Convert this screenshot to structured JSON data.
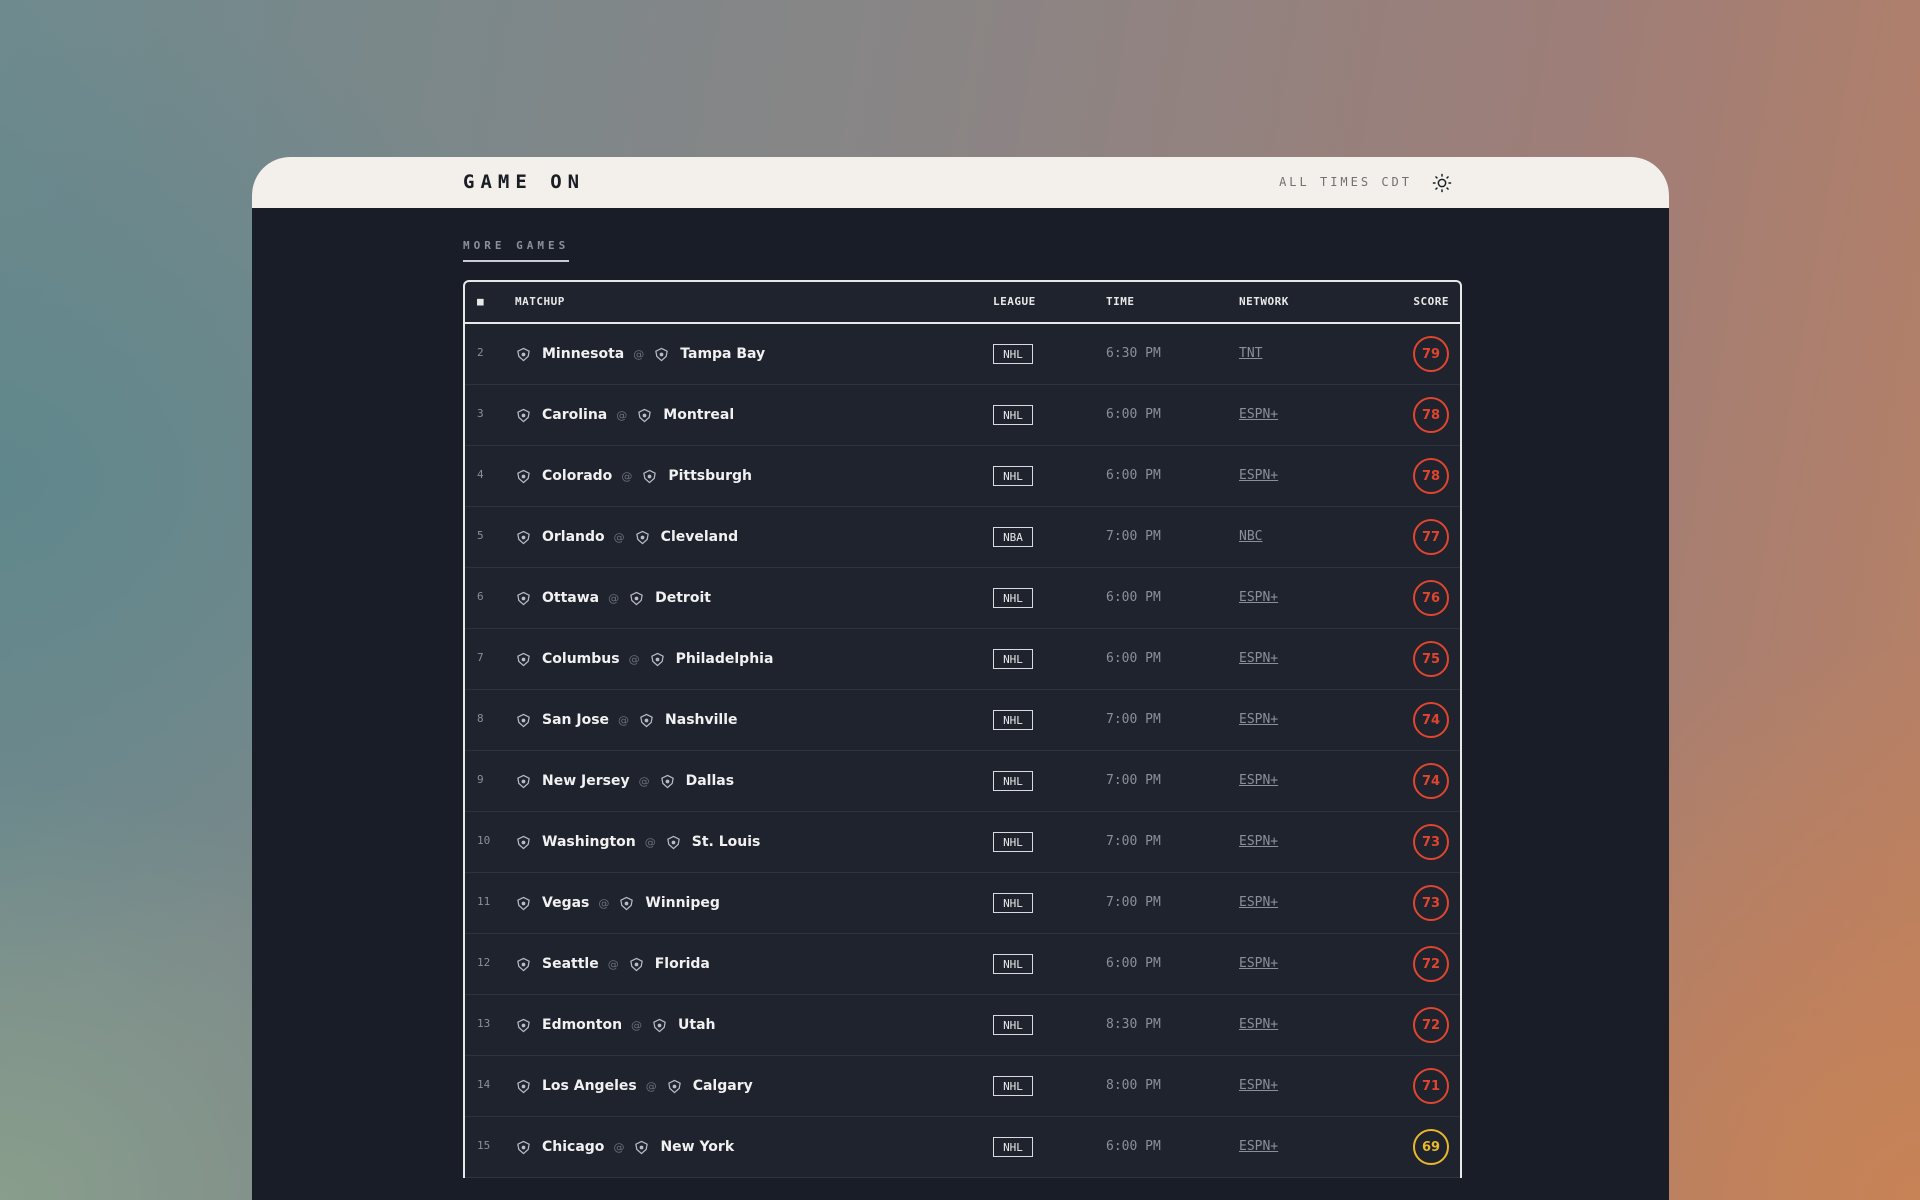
{
  "app": {
    "logo": "GAME ON",
    "times_label": "ALL TIMES CDT"
  },
  "section": {
    "title": "MORE GAMES"
  },
  "table": {
    "headers": {
      "rank": "■",
      "matchup": "MATCHUP",
      "league": "LEAGUE",
      "time": "TIME",
      "network": "NETWORK",
      "score": "SCORE"
    },
    "rows": [
      {
        "rank": "2",
        "away": "Minnesota",
        "home": "Tampa Bay",
        "league": "NHL",
        "time": "6:30 PM",
        "network": "TNT",
        "score": "79",
        "score_color": "#e0452f"
      },
      {
        "rank": "3",
        "away": "Carolina",
        "home": "Montreal",
        "league": "NHL",
        "time": "6:00 PM",
        "network": "ESPN+",
        "score": "78",
        "score_color": "#e0452f"
      },
      {
        "rank": "4",
        "away": "Colorado",
        "home": "Pittsburgh",
        "league": "NHL",
        "time": "6:00 PM",
        "network": "ESPN+",
        "score": "78",
        "score_color": "#e0452f"
      },
      {
        "rank": "5",
        "away": "Orlando",
        "home": "Cleveland",
        "league": "NBA",
        "time": "7:00 PM",
        "network": "NBC",
        "score": "77",
        "score_color": "#e0452f"
      },
      {
        "rank": "6",
        "away": "Ottawa",
        "home": "Detroit",
        "league": "NHL",
        "time": "6:00 PM",
        "network": "ESPN+",
        "score": "76",
        "score_color": "#e0452f"
      },
      {
        "rank": "7",
        "away": "Columbus",
        "home": "Philadelphia",
        "league": "NHL",
        "time": "6:00 PM",
        "network": "ESPN+",
        "score": "75",
        "score_color": "#e0452f"
      },
      {
        "rank": "8",
        "away": "San Jose",
        "home": "Nashville",
        "league": "NHL",
        "time": "7:00 PM",
        "network": "ESPN+",
        "score": "74",
        "score_color": "#e0452f"
      },
      {
        "rank": "9",
        "away": "New Jersey",
        "home": "Dallas",
        "league": "NHL",
        "time": "7:00 PM",
        "network": "ESPN+",
        "score": "74",
        "score_color": "#e0452f"
      },
      {
        "rank": "10",
        "away": "Washington",
        "home": "St. Louis",
        "league": "NHL",
        "time": "7:00 PM",
        "network": "ESPN+",
        "score": "73",
        "score_color": "#e0452f"
      },
      {
        "rank": "11",
        "away": "Vegas",
        "home": "Winnipeg",
        "league": "NHL",
        "time": "7:00 PM",
        "network": "ESPN+",
        "score": "73",
        "score_color": "#e0452f"
      },
      {
        "rank": "12",
        "away": "Seattle",
        "home": "Florida",
        "league": "NHL",
        "time": "6:00 PM",
        "network": "ESPN+",
        "score": "72",
        "score_color": "#e0452f"
      },
      {
        "rank": "13",
        "away": "Edmonton",
        "home": "Utah",
        "league": "NHL",
        "time": "8:30 PM",
        "network": "ESPN+",
        "score": "72",
        "score_color": "#e0452f"
      },
      {
        "rank": "14",
        "away": "Los Angeles",
        "home": "Calgary",
        "league": "NHL",
        "time": "8:00 PM",
        "network": "ESPN+",
        "score": "71",
        "score_color": "#e0452f"
      },
      {
        "rank": "15",
        "away": "Chicago",
        "home": "New York",
        "league": "NHL",
        "time": "6:00 PM",
        "network": "ESPN+",
        "score": "69",
        "score_color": "#e8b82a"
      }
    ]
  },
  "icons": {
    "theme_toggle": "sun-icon",
    "team_logo": "team-logo-icon"
  }
}
